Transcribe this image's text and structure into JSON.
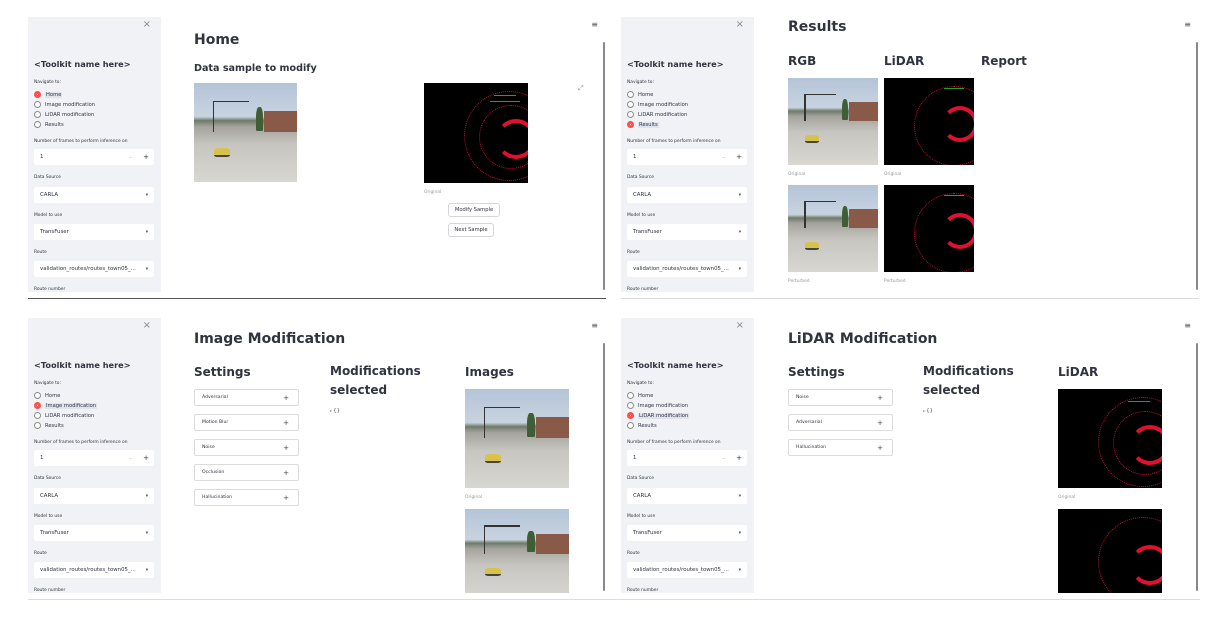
{
  "sidebar": {
    "title": "<Toolkit name here>",
    "navigate_label": "Navigate to:",
    "nav_options": [
      "Home",
      "Image modification",
      "LiDAR modification",
      "Results"
    ],
    "frames_label": "Number of frames to perform inference on",
    "frames_value": "1",
    "data_source_label": "Data Source",
    "data_source_value": "CARLA",
    "model_label": "Model to use",
    "model_value": "TransFuser",
    "route_label": "Route",
    "route_value": "validation_routes/routes_town05_...",
    "route_number_label": "Route number",
    "close_icon": "×",
    "menu_icon": "≡"
  },
  "home": {
    "title": "Home",
    "subtitle": "Data sample to modify",
    "lidar_caption": "Original",
    "modify_button": "Modify Sample",
    "next_button": "Next Sample",
    "selected_nav": "Home"
  },
  "results": {
    "title": "Results",
    "col_rgb": "RGB",
    "col_lidar": "LiDAR",
    "col_report": "Report",
    "caption_original": "Original",
    "caption_perturbed": "Perturbed",
    "selected_nav": "Results"
  },
  "image_mod": {
    "title": "Image Modification",
    "settings": "Settings",
    "modifications": "Modifications selected",
    "images": "Images",
    "options": [
      "Adversarial",
      "Motion Blur",
      "Noise",
      "Occlusion",
      "Hallucination"
    ],
    "json_value": "{}",
    "caption_original": "Original",
    "selected_nav": "Image modification"
  },
  "lidar_mod": {
    "title": "LiDAR Modification",
    "settings": "Settings",
    "modifications": "Modifications selected",
    "lidar": "LiDAR",
    "options": [
      "Noise",
      "Adversarial",
      "Hallucination"
    ],
    "json_value": "{}",
    "caption_original": "Original",
    "selected_nav": "LiDAR modification"
  }
}
